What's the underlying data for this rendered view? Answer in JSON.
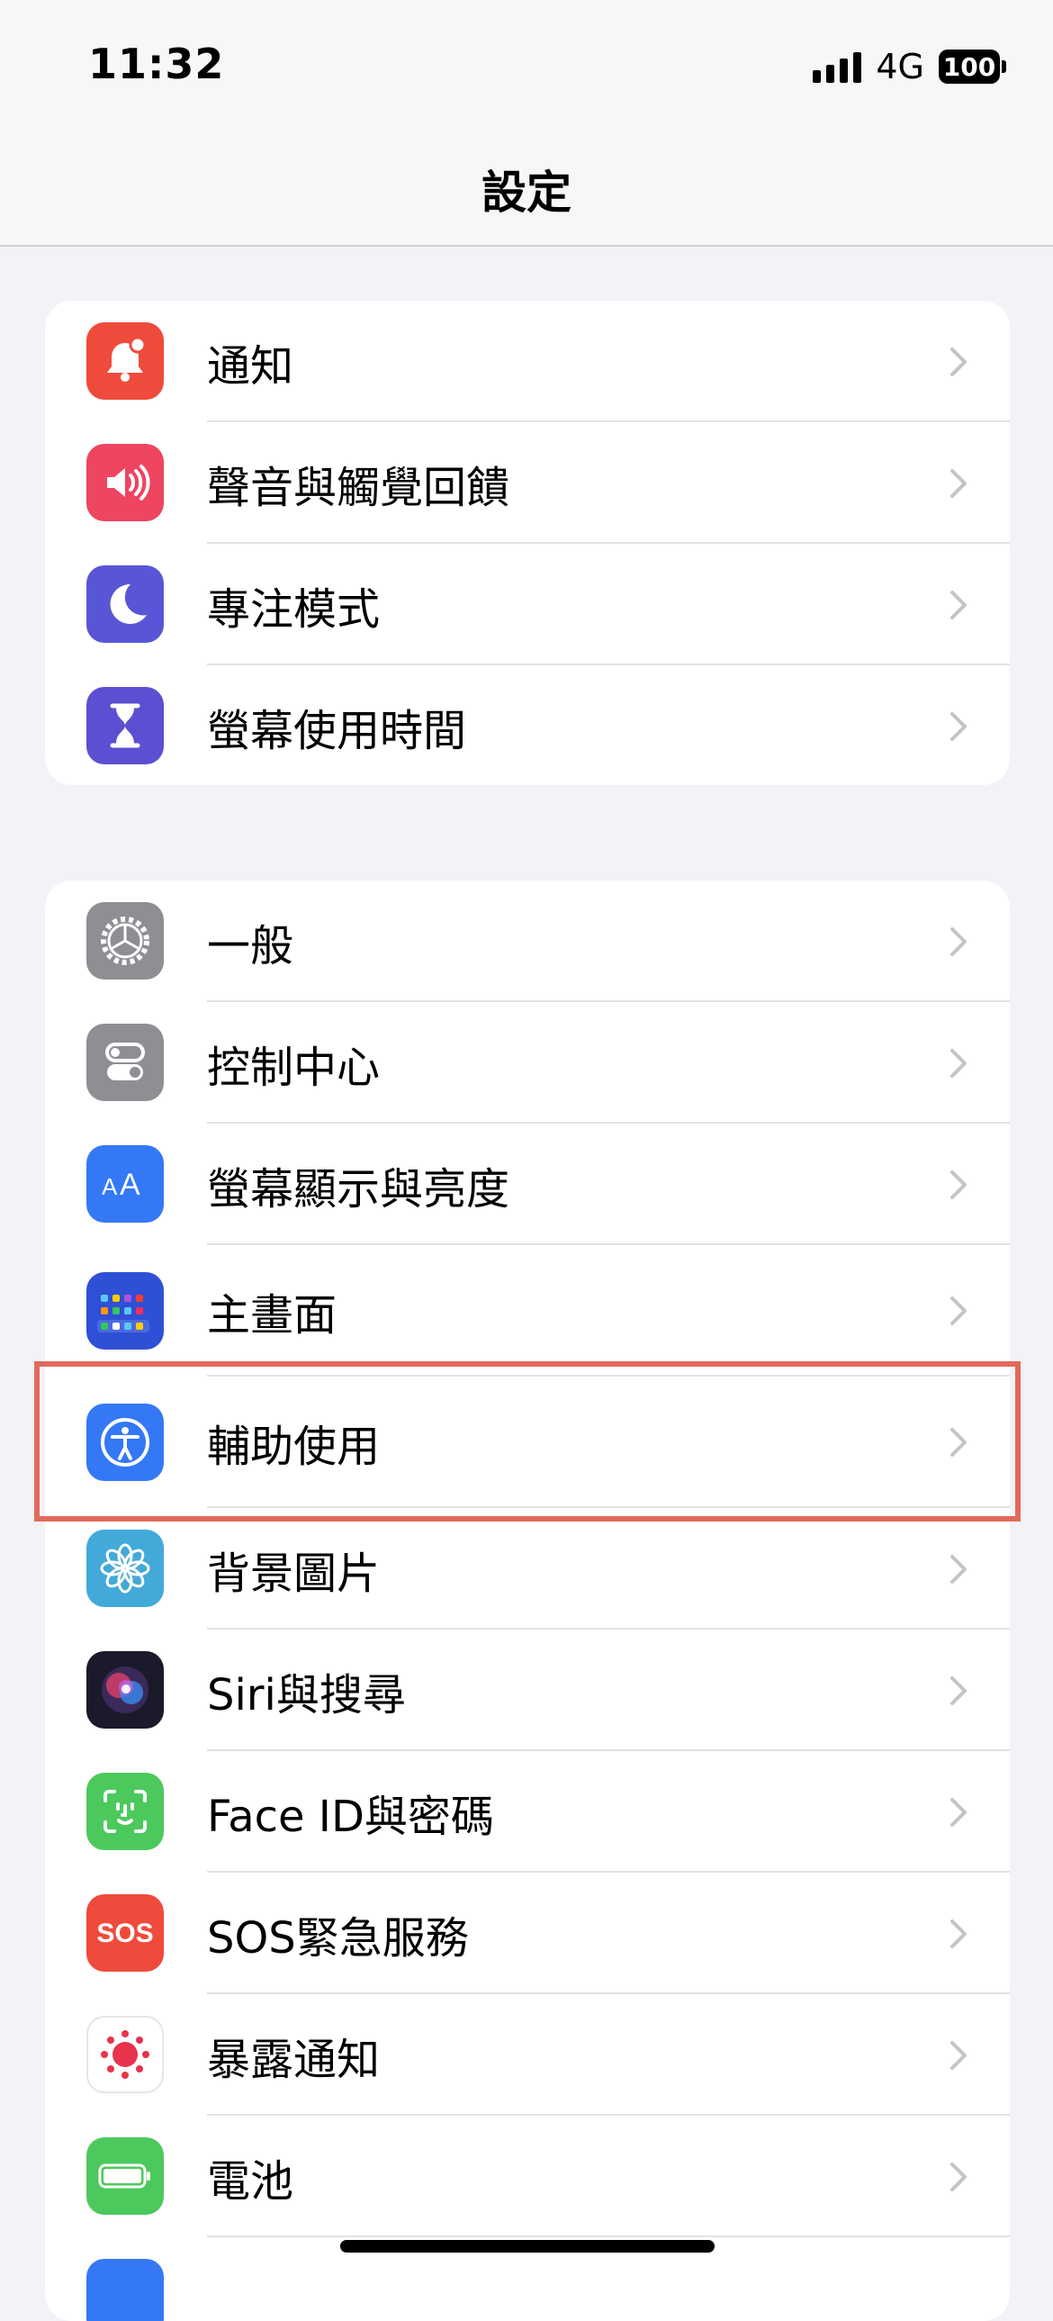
{
  "status": {
    "time": "11:32",
    "network": "4G",
    "battery": "100"
  },
  "nav": {
    "title": "設定"
  },
  "group1": [
    {
      "label": "通知",
      "icon": "notifications-icon",
      "color": "#ef4b3c"
    },
    {
      "label": "聲音與觸覺回饋",
      "icon": "sounds-icon",
      "color": "#ee4560"
    },
    {
      "label": "專注模式",
      "icon": "focus-moon-icon",
      "color": "#5856d6"
    },
    {
      "label": "螢幕使用時間",
      "icon": "screen-time-hourglass-icon",
      "color": "#5c4fd1"
    }
  ],
  "group2": [
    {
      "label": "一般",
      "icon": "gear-icon",
      "color": "#8e8e93"
    },
    {
      "label": "控制中心",
      "icon": "toggles-icon",
      "color": "#8e8e93"
    },
    {
      "label": "螢幕顯示與亮度",
      "icon": "display-aa-icon",
      "color": "#3478f6"
    },
    {
      "label": "主畫面",
      "icon": "home-screen-grid-icon",
      "color": "#2f4fd6"
    },
    {
      "label": "輔助使用",
      "icon": "accessibility-icon",
      "color": "#3478f6"
    },
    {
      "label": "背景圖片",
      "icon": "wallpaper-flower-icon",
      "color": "#43a9d9"
    },
    {
      "label": "Siri與搜尋",
      "icon": "siri-icon",
      "color": "#1a1a2a"
    },
    {
      "label": "Face ID與密碼",
      "icon": "face-id-icon",
      "color": "#4cc95d"
    },
    {
      "label": "SOS緊急服務",
      "icon": "sos-icon",
      "color": "#ef4b3c"
    },
    {
      "label": "暴露通知",
      "icon": "exposure-notification-icon",
      "color": "#e8334c"
    },
    {
      "label": "電池",
      "icon": "battery-icon",
      "color": "#4cc95d"
    }
  ],
  "colors": {
    "highlight": "#e26a5b",
    "chevron": "#c4c4c8"
  }
}
